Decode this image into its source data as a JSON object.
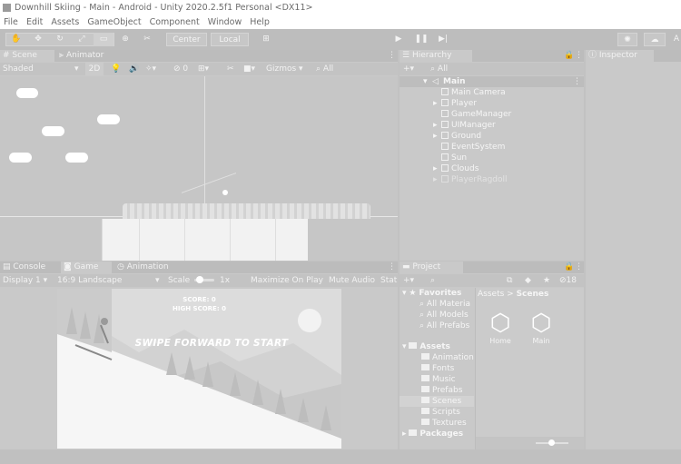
{
  "window": {
    "title": "Downhill Skiing - Main - Android - Unity 2020.2.5f1 Personal <DX11>"
  },
  "menu": [
    "File",
    "Edit",
    "Assets",
    "GameObject",
    "Component",
    "Window",
    "Help"
  ],
  "toolbar": {
    "pivot_label": "Center",
    "space_label": "Local",
    "account_label": "A"
  },
  "scene_tabs": [
    "Scene",
    "Animator"
  ],
  "scene_bar": {
    "shading": "Shaded",
    "mode_2d": "2D",
    "hidden_count": "0",
    "gizmos": "Gizmos",
    "search_placeholder": "All"
  },
  "game_overlay": {
    "score": "SCORE: 0",
    "high_score": "HIGH SCORE: 0",
    "prompt": "SWIPE FORWARD TO START"
  },
  "hierarchy": {
    "tab": "Hierarchy",
    "search_placeholder": "All",
    "scene": "Main",
    "items": [
      "Main Camera",
      "Player",
      "GameManager",
      "UIManager",
      "Ground",
      "EventSystem",
      "Sun",
      "Clouds",
      "PlayerRagdoll"
    ]
  },
  "inspector": {
    "tab": "Inspector"
  },
  "bottom_tabs": [
    "Console",
    "Game",
    "Animation"
  ],
  "game_bar": {
    "display": "Display 1",
    "aspect": "16:9 Landscape",
    "scale_label": "Scale",
    "scale_value": "1x",
    "maximize": "Maximize On Play",
    "mute": "Mute Audio",
    "stats": "Stat"
  },
  "project": {
    "tab": "Project",
    "hidden_count": "18",
    "favorites_label": "Favorites",
    "favorites": [
      "All Materia",
      "All Models",
      "All Prefabs"
    ],
    "assets_label": "Assets",
    "asset_folders": [
      "Animation",
      "Fonts",
      "Music",
      "Prefabs",
      "Scenes",
      "Scripts",
      "Textures"
    ],
    "packages_label": "Packages",
    "breadcrumb": [
      "Assets",
      "Scenes"
    ],
    "files": [
      "Home",
      "Main"
    ]
  },
  "colors": {
    "panel_bg": "#c9c9c9",
    "tab_bg": "#bcbcbc",
    "text_light": "#f4f4f4",
    "window_bg": "#c2c2c2"
  }
}
